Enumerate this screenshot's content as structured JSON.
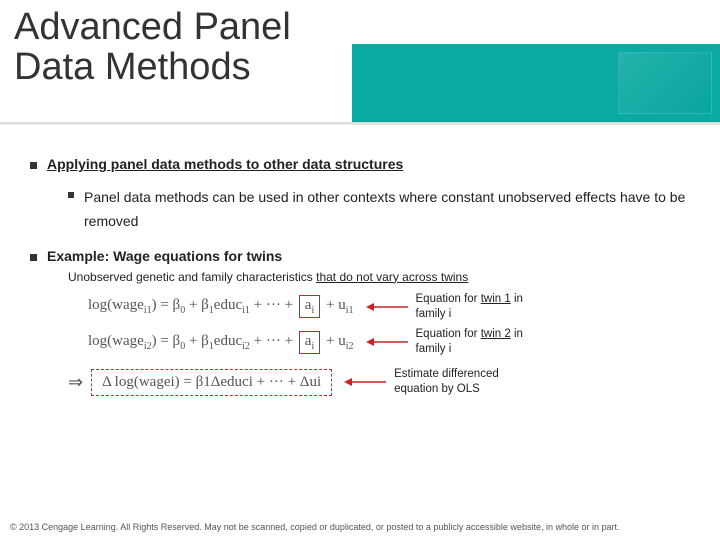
{
  "header": {
    "title": "Advanced Panel\nData Methods"
  },
  "content": {
    "b1": "Applying panel data methods to other data structures",
    "b1a": "Panel data methods can be used in other contexts where constant unobserved effects have to be removed",
    "b2": "Example: Wage equations for twins",
    "note_pre": "Unobserved genetic and family characteristics ",
    "note_ul": "that do not vary across twins",
    "eq1": {
      "lhs": "log(wage",
      "sub1": "i1",
      "mid": ") = β",
      "s0": "0",
      "plus": " + β",
      "s1": "1",
      "ed": "educ",
      "sub2": "i1",
      "dots": " + ··· + ",
      "a": "a",
      "asub": "i",
      "u": " + u",
      "usub": "i1",
      "note_a": "Equation for ",
      "note_ul": "twin 1",
      "note_b": " in family i"
    },
    "eq2": {
      "lhs": "log(wage",
      "sub1": "i2",
      "mid": ") = β",
      "s0": "0",
      "plus": " + β",
      "s1": "1",
      "ed": "educ",
      "sub2": "i2",
      "dots": " + ··· + ",
      "a": "a",
      "asub": "i",
      "u": " + u",
      "usub": "i2",
      "note_a": "Equation for ",
      "note_ul": "twin 2",
      "note_b": " in family i"
    },
    "diff": {
      "lhs": "Δ log(wage",
      "sub1": "i",
      "mid": ") = β",
      "s1": "1",
      "ed": "Δeduc",
      "sub2": "i",
      "dots": " + ··· + Δu",
      "usub": "i",
      "note": "Estimate differenced equation by OLS"
    }
  },
  "footer": "© 2013 Cengage Learning. All Rights Reserved. May not be scanned, copied or duplicated, or posted to a publicly accessible website, in whole or in part."
}
